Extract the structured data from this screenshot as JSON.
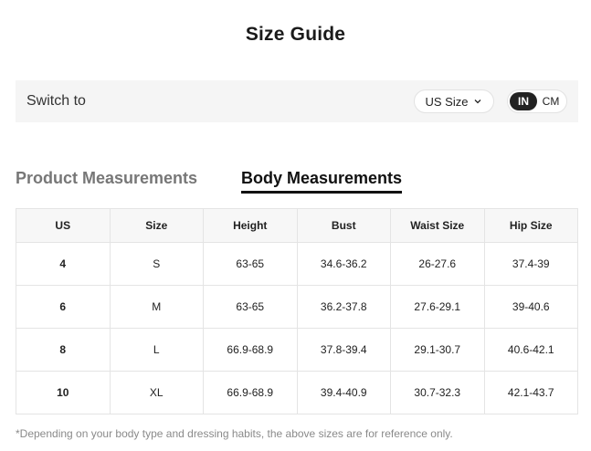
{
  "title": "Size Guide",
  "switch": {
    "label": "Switch to",
    "size_system": "US Size",
    "units": {
      "in": "IN",
      "cm": "CM",
      "selected": "IN"
    }
  },
  "tabs": [
    {
      "label": "Product Measurements",
      "active": false
    },
    {
      "label": "Body Measurements",
      "active": true
    }
  ],
  "table": {
    "headers": [
      "US",
      "Size",
      "Height",
      "Bust",
      "Waist Size",
      "Hip Size"
    ],
    "rows": [
      [
        "4",
        "S",
        "63-65",
        "34.6-36.2",
        "26-27.6",
        "37.4-39"
      ],
      [
        "6",
        "M",
        "63-65",
        "36.2-37.8",
        "27.6-29.1",
        "39-40.6"
      ],
      [
        "8",
        "L",
        "66.9-68.9",
        "37.8-39.4",
        "29.1-30.7",
        "40.6-42.1"
      ],
      [
        "10",
        "XL",
        "66.9-68.9",
        "39.4-40.9",
        "30.7-32.3",
        "42.1-43.7"
      ]
    ]
  },
  "footnote": "*Depending on your body type and dressing habits, the above sizes are for reference only.",
  "icons": {
    "size_select": "chevron-down-icon"
  }
}
